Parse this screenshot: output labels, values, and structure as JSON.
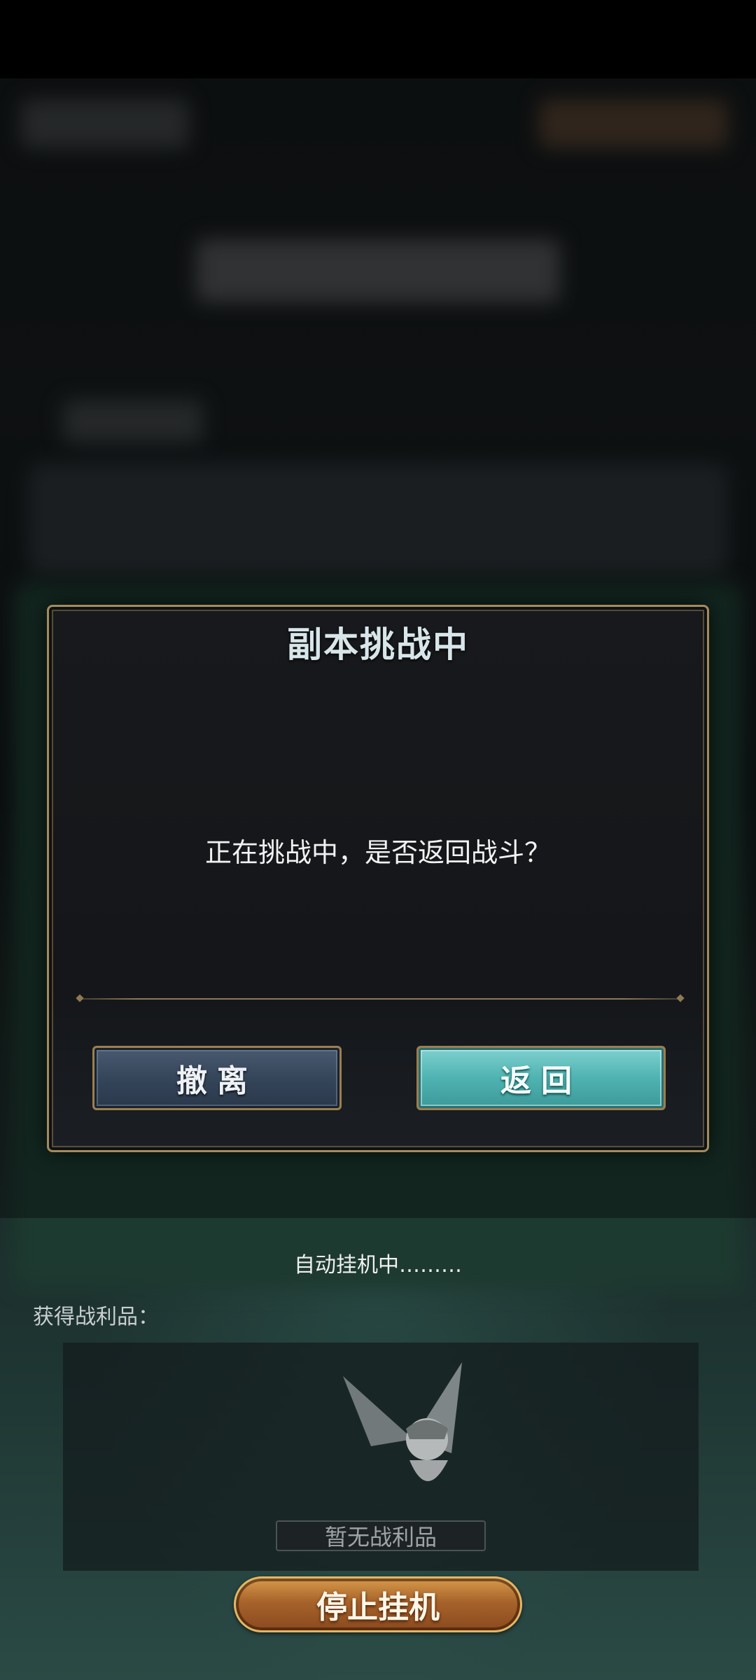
{
  "dialog": {
    "title": "副本挑战中",
    "message": "正在挑战中，是否返回战斗？",
    "leave_label": "撤离",
    "return_label": "返回"
  },
  "bottom": {
    "auto_status": "自动挂机中………",
    "loot_label": "获得战利品：",
    "empty_loot": "暂无战利品",
    "stop_label": "停止挂机"
  },
  "colors": {
    "accent_gold": "#a48b5c",
    "return_teal": "#4fb3b1",
    "leave_slate": "#35455a",
    "stop_bronze": "#a7632b"
  }
}
